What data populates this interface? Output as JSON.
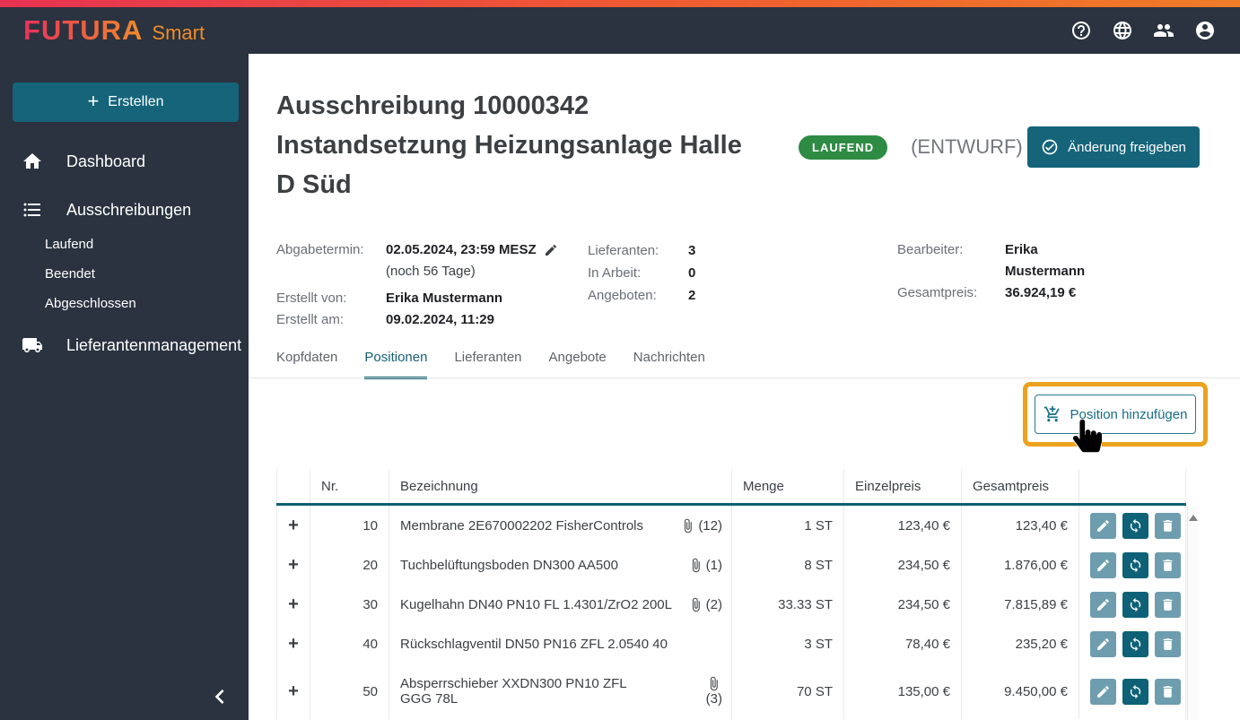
{
  "topbar": {
    "brand": "FUTURA",
    "brand_suffix": "Smart",
    "icons": [
      "help-icon",
      "language-globe-icon",
      "user-groups-icon",
      "account-icon"
    ]
  },
  "sidebar": {
    "create_label": "Erstellen",
    "dashboard_label": "Dashboard",
    "ausschreibungen_label": "Ausschreibungen",
    "sub_items": [
      "Laufend",
      "Beendet",
      "Abgeschlossen"
    ],
    "lieferanten_label": "Lieferantenmanagement"
  },
  "header": {
    "title": "Ausschreibung 10000342 Instandsetzung Heizungsanlage Halle D Süd",
    "status_badge": "LAUFEND",
    "status_secondary": "(ENTWURF)",
    "approve_button": "Änderung freigeben"
  },
  "meta": {
    "abgabetermin_label": "Abgabetermin:",
    "abgabetermin_value": "02.05.2024, 23:59 MESZ",
    "abgabetermin_note": "(noch 56 Tage)",
    "erstellt_von_label": "Erstellt von:",
    "erstellt_von_value": "Erika Mustermann",
    "erstellt_am_label": "Erstellt am:",
    "erstellt_am_value": "09.02.2024, 11:29",
    "lieferanten_label": "Lieferanten:",
    "lieferanten_value": "3",
    "in_arbeit_label": "In Arbeit:",
    "in_arbeit_value": "0",
    "angeboten_label": "Angeboten:",
    "angeboten_value": "2",
    "bearbeiter_label": "Bearbeiter:",
    "bearbeiter_value": "Erika Mustermann",
    "gesamtpreis_label": "Gesamtpreis:",
    "gesamtpreis_value": "36.924,19 €"
  },
  "tabs": {
    "items": [
      "Kopfdaten",
      "Positionen",
      "Lieferanten",
      "Angebote",
      "Nachrichten"
    ],
    "active": "Positionen"
  },
  "toolbar": {
    "add_position": "Position hinzufügen"
  },
  "table": {
    "columns": {
      "nr": "Nr.",
      "bezeichnung": "Bezeichnung",
      "menge": "Menge",
      "einzelpreis": "Einzelpreis",
      "gesamtpreis": "Gesamtpreis"
    },
    "rows": [
      {
        "nr": "10",
        "bezeichnung": "Membrane 2E670002202 FisherControls",
        "attachments": "(12)",
        "menge": "1 ST",
        "einzelpreis": "123,40 €",
        "gesamtpreis": "123,40 €"
      },
      {
        "nr": "20",
        "bezeichnung": "Tuchbelüftungsboden DN300 AA500",
        "attachments": "(1)",
        "menge": "8 ST",
        "einzelpreis": "234,50 €",
        "gesamtpreis": "1.876,00 €"
      },
      {
        "nr": "30",
        "bezeichnung": "Kugelhahn DN40 PN10 FL 1.4301/ZrO2 200L",
        "attachments": "(2)",
        "menge": "33.33 ST",
        "einzelpreis": "234,50 €",
        "gesamtpreis": "7.815,89 €"
      },
      {
        "nr": "40",
        "bezeichnung": "Rückschlagventil DN50 PN16 ZFL 2.0540 40",
        "attachments": "",
        "menge": "3 ST",
        "einzelpreis": "78,40 €",
        "gesamtpreis": "235,20 €"
      },
      {
        "nr": "50",
        "bezeichnung": "Absperrschieber XXDN300 PN10 ZFL GGG 78L",
        "attachments": "(3)",
        "menge": "70 ST",
        "einzelpreis": "135,00 €",
        "gesamtpreis": "9.450,00 €"
      }
    ]
  },
  "colors": {
    "header_dark": "#2a333f",
    "accent_teal": "#15647a",
    "tab_active_teal": "#0d5f70",
    "badge_green": "#2e8b43",
    "annotation_orange": "#eba21c",
    "action_button_light": "#6d9dae",
    "action_button_dark": "#0e6177",
    "brand_gradient_start": "#e9315b",
    "brand_gradient_end": "#f08c2a"
  }
}
